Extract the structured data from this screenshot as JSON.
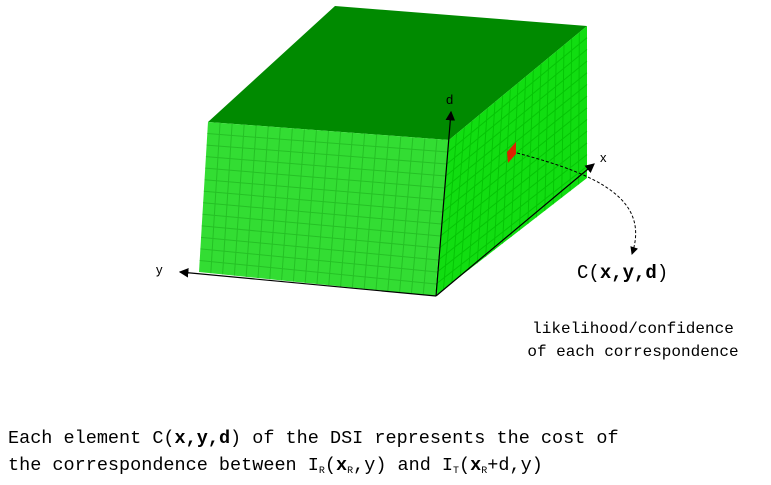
{
  "colors": {
    "top_face": "#008a00",
    "front_face": "#33dd33",
    "side_face": "#11dd11",
    "grid": "#22bb22",
    "highlight_cell": "#dd2200"
  },
  "axes": {
    "d_label": "d",
    "x_label": "x",
    "y_label": "y"
  },
  "cost_label": {
    "prefix": "C(",
    "vars": "x,y,d",
    "suffix": ")"
  },
  "legend": {
    "line1": "likelihood/confidence",
    "line2": "of each correspondence"
  },
  "caption": {
    "line1_a": "Each element C(",
    "line1_b": "x,y,d",
    "line1_c": ") of the DSI represents the cost of",
    "line2_a": "the correspondence between I",
    "line2_sub1": "R",
    "line2_b": "(",
    "line2_x1": "x",
    "line2_sub2": "R",
    "line2_c": ",y) and I",
    "line2_sub3": "T",
    "line2_d": "(",
    "line2_x2": "x",
    "line2_sub4": "R",
    "line2_e": "+d,y)"
  }
}
